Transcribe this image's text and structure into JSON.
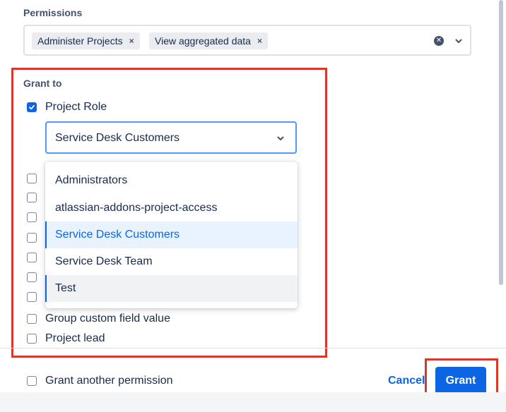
{
  "permissions": {
    "label": "Permissions",
    "tags": [
      {
        "label": "Administer Projects",
        "remove": "×"
      },
      {
        "label": "View aggregated data",
        "remove": "×"
      }
    ],
    "clear_icon": "clear-icon",
    "dropdown_icon": "chevron-down-icon"
  },
  "grant_to": {
    "label": "Grant to",
    "project_role": {
      "label": "Project Role",
      "checked": true
    },
    "role_select": {
      "value": "Service Desk Customers",
      "dropdown_icon": "chevron-down-icon"
    },
    "role_options": [
      {
        "label": "Administrators",
        "state": "normal"
      },
      {
        "label": "atlassian-addons-project-access",
        "state": "normal"
      },
      {
        "label": "Service Desk Customers",
        "state": "selected"
      },
      {
        "label": "Service Desk Team",
        "state": "normal"
      },
      {
        "label": "Test",
        "state": "hovered"
      }
    ],
    "other_options": [
      {
        "label": "Group custom field value",
        "checked": false
      },
      {
        "label": "Project lead",
        "checked": false
      }
    ]
  },
  "footer": {
    "grant_another": {
      "label": "Grant another permission",
      "checked": false
    },
    "cancel_label": "Cancel",
    "grant_label": "Grant"
  },
  "colors": {
    "accent": "#0c66e4",
    "highlight_outline": "#d63a2d"
  }
}
